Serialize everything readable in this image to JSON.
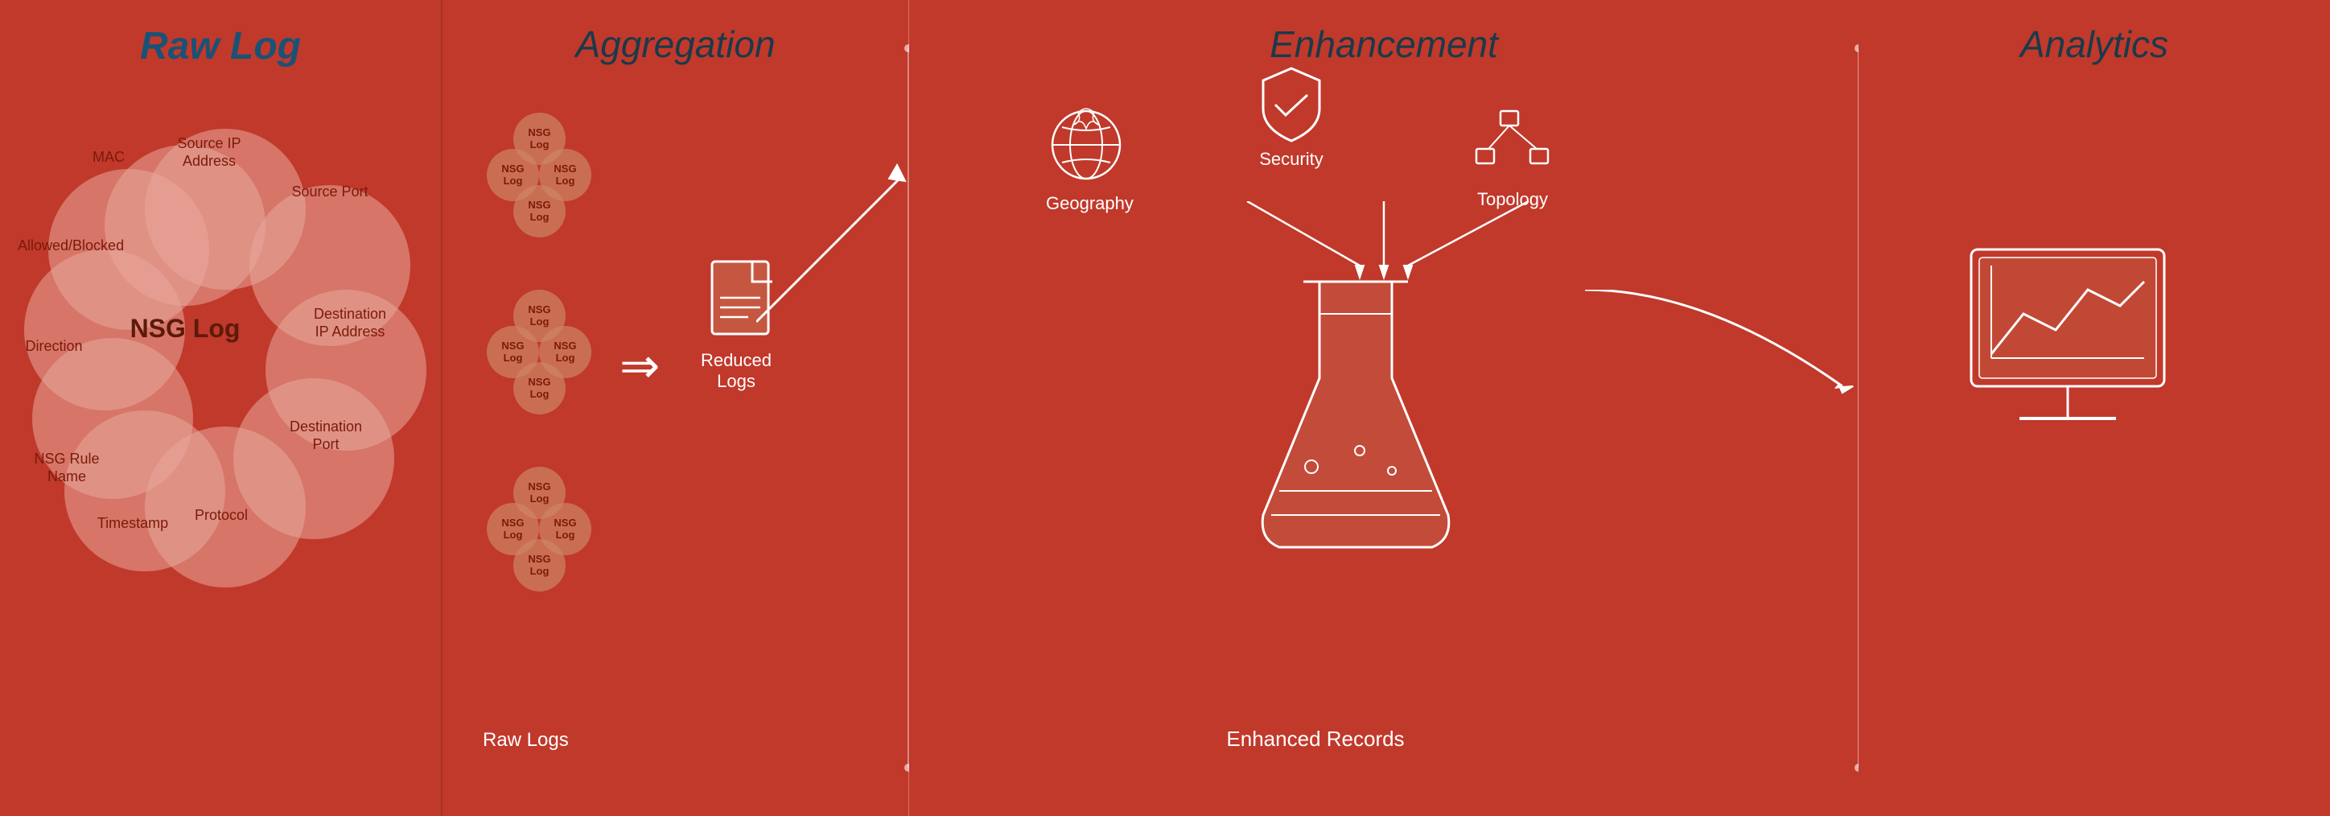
{
  "rawLog": {
    "title": "Raw Log",
    "centerLabel": "NSG Log",
    "circleLabels": [
      "MAC",
      "Source IP Address",
      "Source Port",
      "Destination IP\nAddress",
      "Destination Port",
      "Protocol",
      "Timestamp",
      "NSG Rule Name",
      "Direction",
      "Allowed/Blocked"
    ]
  },
  "aggregation": {
    "title": "Aggregation",
    "groups": [
      {
        "label": "NSG\nLog"
      },
      {
        "label": "NSG\nLog"
      },
      {
        "label": "NSG\nLog"
      }
    ],
    "rawLogsLabel": "Raw Logs",
    "reducedLogsLabel": "Reduced Logs"
  },
  "enhancement": {
    "title": "Enhancement",
    "labels": {
      "geography": "Geography",
      "security": "Security",
      "topology": "Topology",
      "enhancedRecords": "Enhanced Records"
    }
  },
  "analytics": {
    "title": "Analytics"
  },
  "colors": {
    "background": "#c0392b",
    "titleBlue": "#1a5276",
    "darkRed": "#7b1a0a",
    "bubbleColor": "rgba(205,133,100,0.7)",
    "circleColor": "rgba(231,168,155,0.55)",
    "white": "#ffffff",
    "dividerWhite": "rgba(255,255,255,0.5)"
  }
}
